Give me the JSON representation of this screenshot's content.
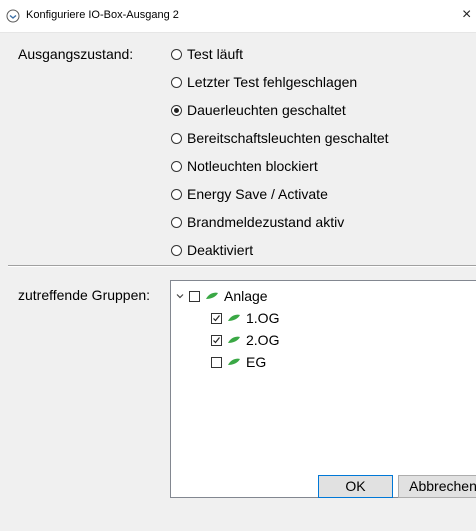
{
  "window": {
    "title": "Konfiguriere IO-Box-Ausgang 2",
    "close_glyph": "×"
  },
  "output_state": {
    "label": "Ausgangszustand:",
    "options": [
      {
        "label": "Test läuft",
        "selected": false
      },
      {
        "label": "Letzter Test fehlgeschlagen",
        "selected": false
      },
      {
        "label": "Dauerleuchten geschaltet",
        "selected": true
      },
      {
        "label": "Bereitschaftsleuchten geschaltet",
        "selected": false
      },
      {
        "label": "Notleuchten blockiert",
        "selected": false
      },
      {
        "label": "Energy Save / Activate",
        "selected": false
      },
      {
        "label": "Brandmeldezustand aktiv",
        "selected": false
      },
      {
        "label": "Deaktiviert",
        "selected": false
      }
    ]
  },
  "groups": {
    "label": "zutreffende Gruppen:",
    "tree": [
      {
        "label": "Anlage",
        "checked": false,
        "expanded": true,
        "level": 0,
        "icon": "leaf-icon"
      },
      {
        "label": "1.OG",
        "checked": true,
        "level": 1,
        "icon": "leaf-icon"
      },
      {
        "label": "2.OG",
        "checked": true,
        "level": 1,
        "icon": "leaf-icon"
      },
      {
        "label": "EG",
        "checked": false,
        "level": 1,
        "icon": "leaf-icon"
      }
    ]
  },
  "buttons": {
    "ok": "OK",
    "cancel": "Abbrechen"
  },
  "colors": {
    "leaf": "#3aa845",
    "accent": "#0078d7"
  }
}
